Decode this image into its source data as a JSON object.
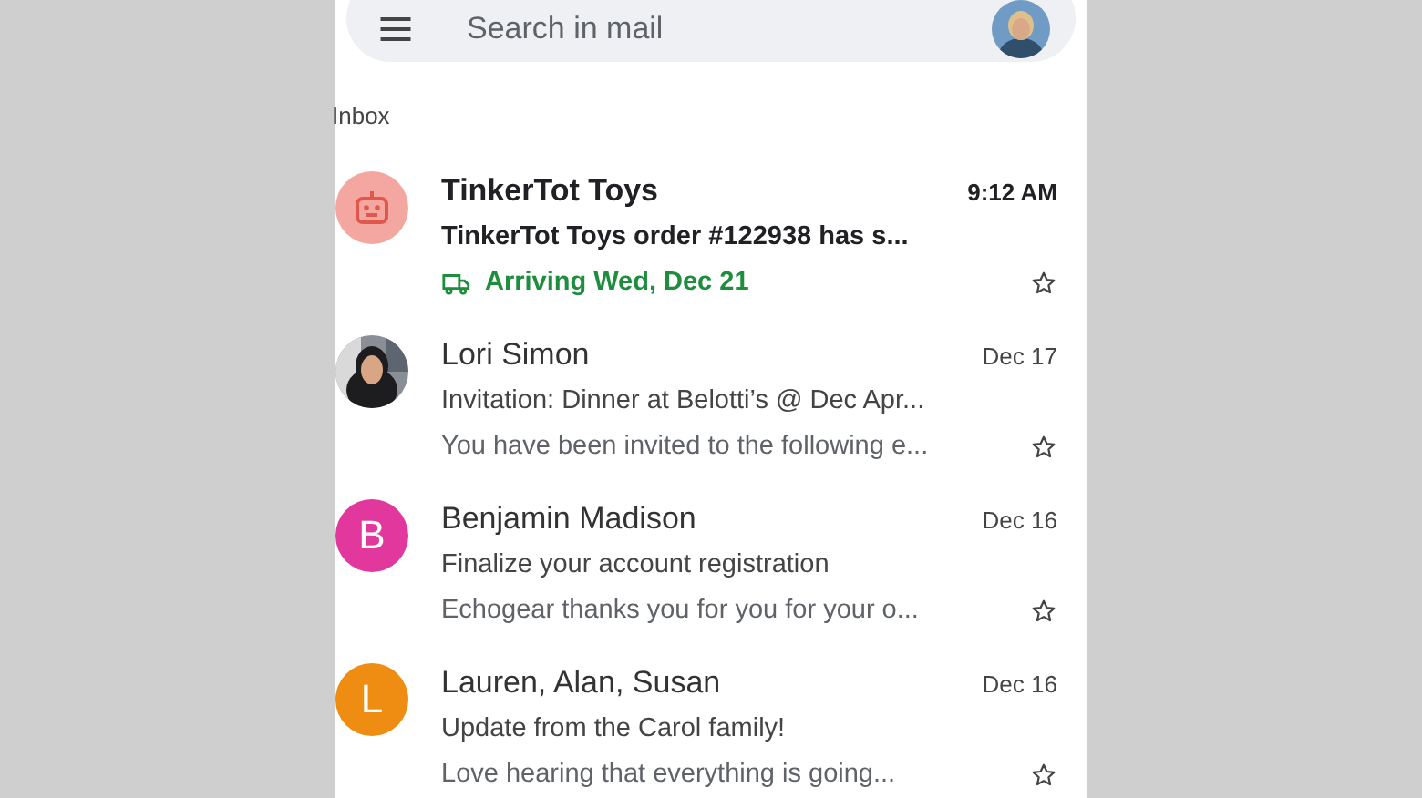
{
  "search": {
    "placeholder": "Search in mail"
  },
  "section_title": "Inbox",
  "emails": [
    {
      "sender": "TinkerTot Toys",
      "subject": "TinkerTot Toys order #122938 has s...",
      "time": "9:12 AM",
      "unread": true,
      "starred": false,
      "avatar": {
        "kind": "icon",
        "color": "#f4a7a0"
      },
      "status": "Arriving Wed, Dec 21"
    },
    {
      "sender": "Lori Simon",
      "subject": "Invitation: Dinner at Belotti’s @ Dec Apr...",
      "snippet": "You have been invited to the following e...",
      "time": "Dec 17",
      "unread": false,
      "starred": false
    },
    {
      "sender": "Benjamin Madison",
      "subject": "Finalize your account registration",
      "snippet": "Echogear thanks you for you for your o...",
      "time": "Dec 16",
      "unread": false,
      "starred": false,
      "avatar": {
        "kind": "letter",
        "letter": "B",
        "color": "#e2389e"
      }
    },
    {
      "sender": "Lauren, Alan, Susan",
      "subject": "Update from the Carol family!",
      "snippet": "Love hearing that everything is going...",
      "time": "Dec 16",
      "unread": false,
      "starred": false,
      "avatar": {
        "kind": "letter",
        "letter": "L",
        "color": "#ef8d12"
      }
    }
  ]
}
